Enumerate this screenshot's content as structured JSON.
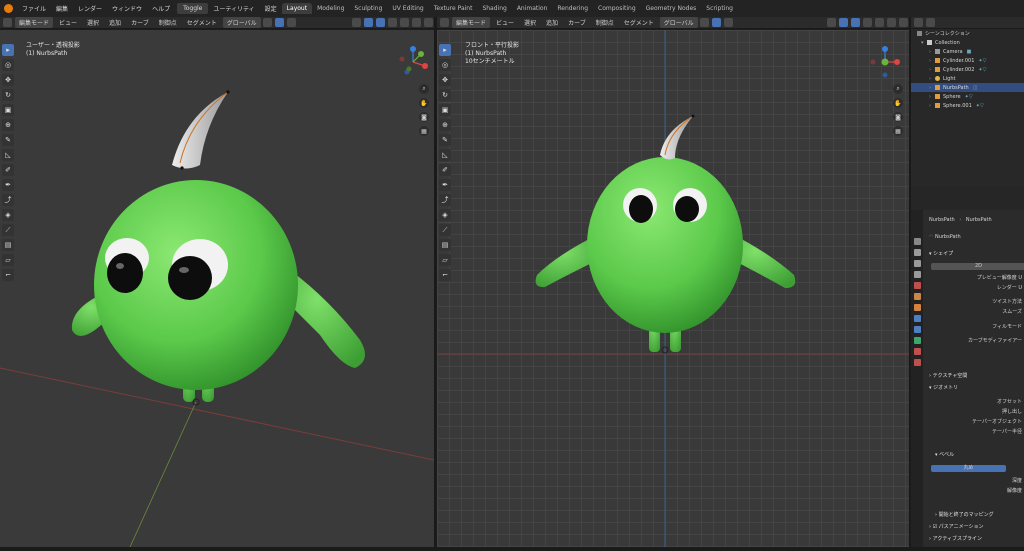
{
  "menubar": {
    "items": [
      "ファイル",
      "編集",
      "レンダー",
      "ウィンドウ",
      "ヘルプ"
    ],
    "toggle": "Toggle",
    "items2": [
      "ユーティリティ",
      "設定"
    ],
    "workspaces": [
      "Layout",
      "Modeling",
      "Sculpting",
      "UV Editing",
      "Texture Paint",
      "Shading",
      "Animation",
      "Rendering",
      "Compositing",
      "Geometry Nodes",
      "Scripting"
    ],
    "active_workspace": "Layout"
  },
  "left_header": {
    "mode": "編集モード",
    "menus": [
      "ビュー",
      "選択",
      "追加",
      "カーブ",
      "制御点",
      "セグメント"
    ],
    "transform": "グローバル"
  },
  "right_header": {
    "mode": "編集モード",
    "menus": [
      "ビュー",
      "選択",
      "追加",
      "カーブ",
      "制御点",
      "セグメント"
    ],
    "transform": "グローバル"
  },
  "left_viewport": {
    "line1": "ユーザー・透視投影",
    "line2": "(1) NurbsPath"
  },
  "right_viewport": {
    "line1": "フロント・平行投影",
    "line2": "(1) NurbsPath",
    "line3": "10センチメートル"
  },
  "outliner": {
    "title": "シーンコレクション",
    "collection": "Collection",
    "items": [
      {
        "name": "Camera",
        "color": "#a0a0a0"
      },
      {
        "name": "Cylinder.001",
        "color": "#e09b3d"
      },
      {
        "name": "Cylinder.002",
        "color": "#e09b3d"
      },
      {
        "name": "Light",
        "color": "#e0b84a"
      },
      {
        "name": "NurbsPath",
        "color": "#e09b3d"
      },
      {
        "name": "Sphere",
        "color": "#e09b3d"
      },
      {
        "name": "Sphere.001",
        "color": "#e09b3d"
      }
    ],
    "selected": "NurbsPath"
  },
  "properties": {
    "breadcrumb1": "NurbsPath",
    "breadcrumb2": "NurbsPath",
    "data_name": "NurbsPath",
    "shape_panel": "シェイプ",
    "dim": "2D",
    "preview_res": "プレビュー解像度 U",
    "render_res": "レンダー U",
    "twist": "ツイスト方法",
    "smooth": "スムーズ",
    "fill": "フィルモード",
    "curve_mod": "カーブモディファイアー",
    "texture_panel": "テクスチャ空間",
    "geometry_panel": "ジオメトリ",
    "offset": "オフセット",
    "extrude": "押し出し",
    "taper_obj": "テーパーオブジェクト",
    "taper_radius": "テーパー半径",
    "bevel_panel": "ベベル",
    "bevel_round": "丸め",
    "depth": "深度",
    "resolution": "解像度",
    "mapping": "開始と終了のマッピング",
    "path_anim": "パスアニメーション",
    "active_spline": "アクティブスプライン"
  }
}
